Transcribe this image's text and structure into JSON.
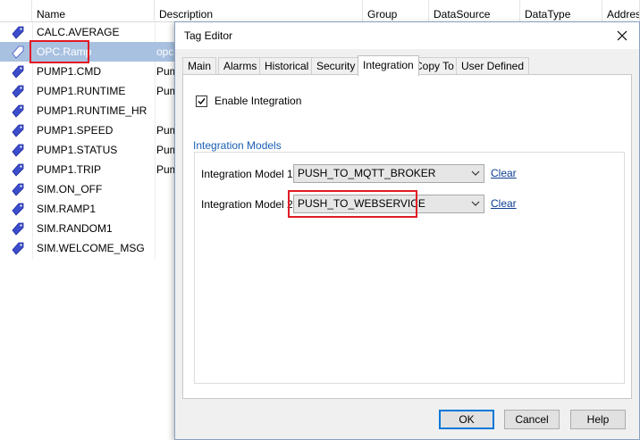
{
  "grid": {
    "columns": [
      {
        "label": "Name"
      },
      {
        "label": "Description"
      },
      {
        "label": "Group"
      },
      {
        "label": "DataSource"
      },
      {
        "label": "DataType"
      },
      {
        "label": "Address"
      }
    ],
    "rows": [
      {
        "name": "CALC.AVERAGE",
        "desc": ""
      },
      {
        "name": "OPC.Ramp",
        "desc": "opc",
        "selected": true
      },
      {
        "name": "PUMP1.CMD",
        "desc": "Pum"
      },
      {
        "name": "PUMP1.RUNTIME",
        "desc": "Pum"
      },
      {
        "name": "PUMP1.RUNTIME_HR",
        "desc": ""
      },
      {
        "name": "PUMP1.SPEED",
        "desc": "Pum"
      },
      {
        "name": "PUMP1.STATUS",
        "desc": "Pum"
      },
      {
        "name": "PUMP1.TRIP",
        "desc": "Pum"
      },
      {
        "name": "SIM.ON_OFF",
        "desc": ""
      },
      {
        "name": "SIM.RAMP1",
        "desc": ""
      },
      {
        "name": "SIM.RANDOM1",
        "desc": ""
      },
      {
        "name": "SIM.WELCOME_MSG",
        "desc": ""
      }
    ],
    "tag_icon_color": "#3c4dcc",
    "selected_row_color": "#a8c1e0"
  },
  "dialog": {
    "title": "Tag Editor",
    "tabs": [
      "Main",
      "Alarms",
      "Historical",
      "Security",
      "Integration",
      "Copy To",
      "User Defined"
    ],
    "active_tab": "Integration",
    "enable_integration": {
      "label": "Enable Integration",
      "checked": true
    },
    "group_title": "Integration Models",
    "model1": {
      "label": "Integration Model 1",
      "value": "PUSH_TO_MQTT_BROKER",
      "clear": "Clear"
    },
    "model2": {
      "label": "Integration Model 2",
      "value": "PUSH_TO_WEBSERVICE",
      "clear": "Clear"
    },
    "buttons": {
      "ok": "OK",
      "cancel": "Cancel",
      "help": "Help"
    },
    "accent_color": "#0078d7",
    "highlight_color": "#e01b24"
  }
}
